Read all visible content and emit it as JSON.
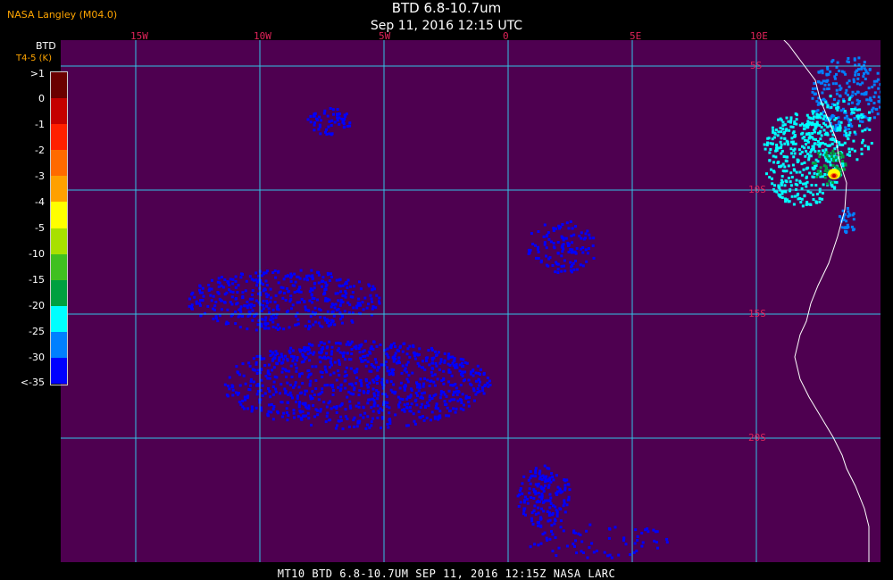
{
  "header": {
    "agency": "NASA Langley (M04.0)",
    "title": "BTD 6.8-10.7um",
    "time": "Sep 11, 2016 12:15 UTC"
  },
  "colorbar": {
    "title": "BTD",
    "subtitle": "T4-5 (K)",
    "labels": [
      ">1",
      "0",
      "-1",
      "-2",
      "-3",
      "-4",
      "-5",
      "-10",
      "-15",
      "-20",
      "-25",
      "-30",
      "<-35"
    ],
    "colors": [
      "#6a0000",
      "#c40000",
      "#ff2000",
      "#ff6a00",
      "#ffa000",
      "#ffff00",
      "#a8e000",
      "#40c020",
      "#00a040",
      "#00ffff",
      "#0080ff",
      "#0000ff",
      "#4e0050"
    ]
  },
  "map": {
    "background_color": "#4e0050",
    "grid_color": "#33c4e6",
    "coast_color": "#ffffff",
    "lon_labels": [
      "15W",
      "10W",
      "5W",
      "0",
      "5E",
      "10E"
    ],
    "lat_labels": [
      "5S",
      "10S",
      "15S",
      "20S"
    ]
  },
  "footer": "MT10  BTD 6.8-10.7UM  SEP 11, 2016 12:15Z  NASA LARC"
}
